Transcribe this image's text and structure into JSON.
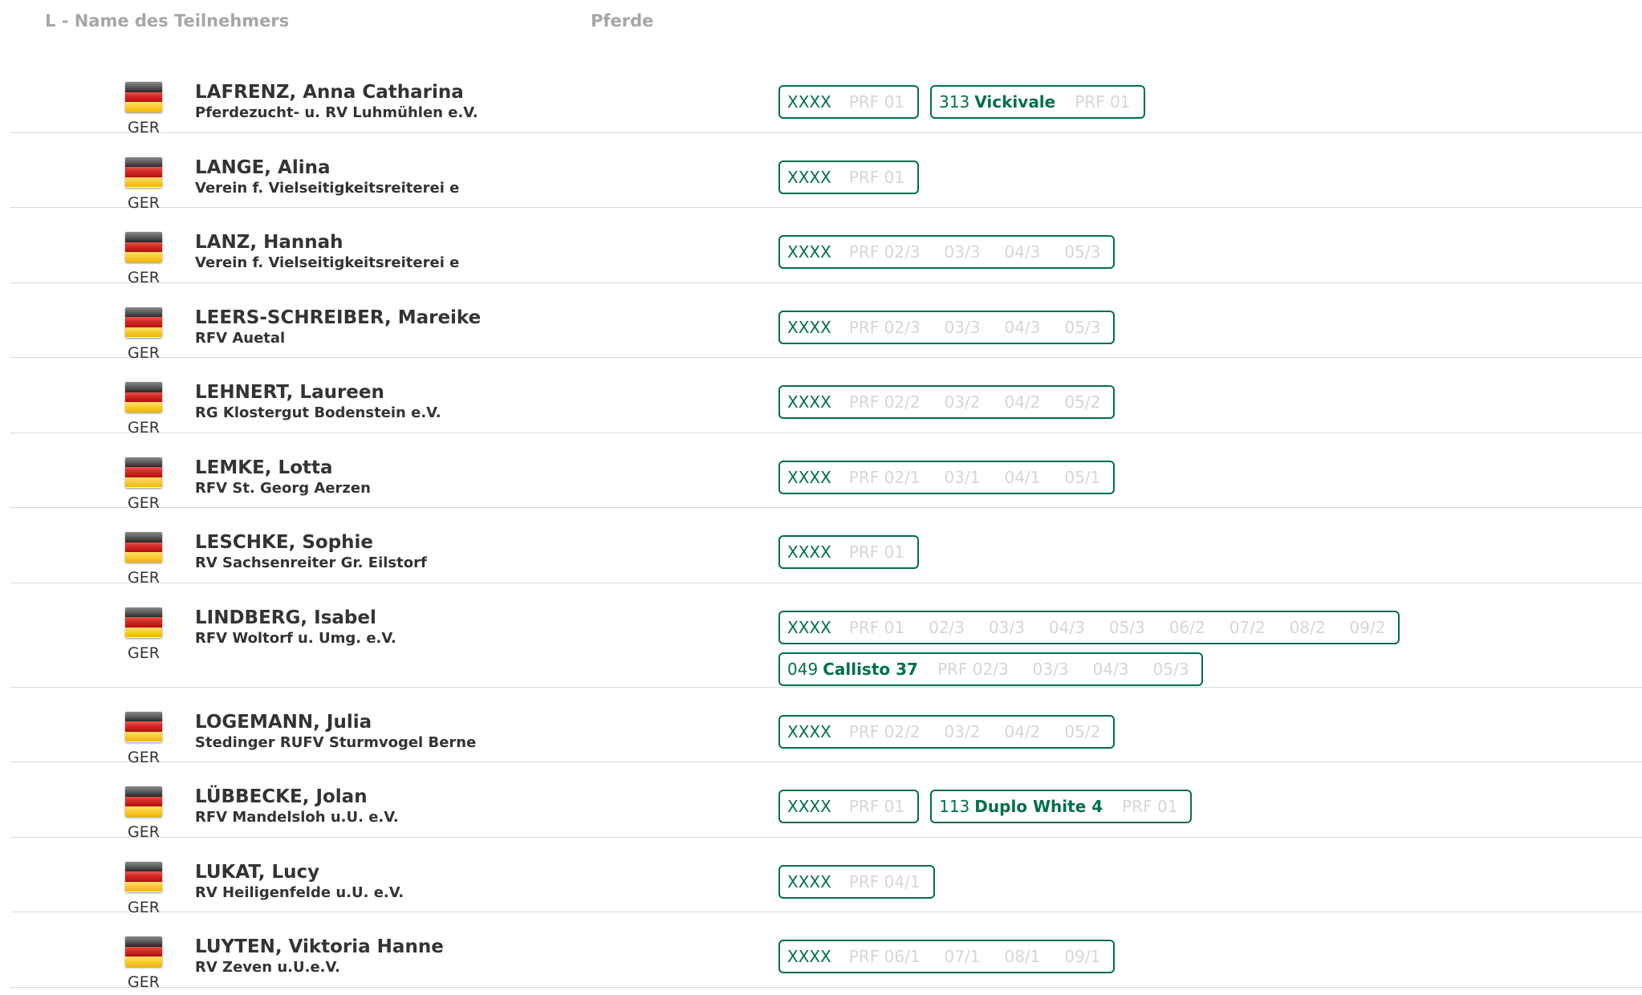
{
  "header": {
    "name_col": "L - Name des Teilnehmers",
    "horses_col": "Pferde"
  },
  "colors": {
    "accent": "#00704a",
    "muted": "#d6d6d6",
    "text": "#333333"
  },
  "riders": [
    {
      "name": "LAFRENZ, Anna Catharina",
      "club": "Pferdezucht- u. RV Luhmühlen e.V.",
      "country": "GER",
      "flag": "germany-flag-icon",
      "entry_lines": [
        [
          {
            "number": "XXXX",
            "horse": "",
            "results": [
              "PRF 01"
            ]
          },
          {
            "number": "313",
            "horse": "Vickivale",
            "results": [
              "PRF 01"
            ]
          }
        ]
      ]
    },
    {
      "name": "LANGE, Alina",
      "club": "Verein f. Vielseitigkeitsreiterei e",
      "country": "GER",
      "flag": "germany-flag-icon",
      "entry_lines": [
        [
          {
            "number": "XXXX",
            "horse": "",
            "results": [
              "PRF 01"
            ]
          }
        ]
      ]
    },
    {
      "name": "LANZ, Hannah",
      "club": "Verein f. Vielseitigkeitsreiterei e",
      "country": "GER",
      "flag": "germany-flag-icon",
      "entry_lines": [
        [
          {
            "number": "XXXX",
            "horse": "",
            "results": [
              "PRF 02/3",
              "03/3",
              "04/3",
              "05/3"
            ]
          }
        ]
      ]
    },
    {
      "name": "LEERS-SCHREIBER, Mareike",
      "club": "RFV Auetal",
      "country": "GER",
      "flag": "germany-flag-icon",
      "entry_lines": [
        [
          {
            "number": "XXXX",
            "horse": "",
            "results": [
              "PRF 02/3",
              "03/3",
              "04/3",
              "05/3"
            ]
          }
        ]
      ]
    },
    {
      "name": "LEHNERT, Laureen",
      "club": "RG Klostergut Bodenstein e.V.",
      "country": "GER",
      "flag": "germany-flag-icon",
      "entry_lines": [
        [
          {
            "number": "XXXX",
            "horse": "",
            "results": [
              "PRF 02/2",
              "03/2",
              "04/2",
              "05/2"
            ]
          }
        ]
      ]
    },
    {
      "name": "LEMKE, Lotta",
      "club": "RFV St. Georg Aerzen",
      "country": "GER",
      "flag": "germany-flag-icon",
      "entry_lines": [
        [
          {
            "number": "XXXX",
            "horse": "",
            "results": [
              "PRF 02/1",
              "03/1",
              "04/1",
              "05/1"
            ]
          }
        ]
      ]
    },
    {
      "name": "LESCHKE, Sophie",
      "club": "RV Sachsenreiter Gr. Eilstorf",
      "country": "GER",
      "flag": "germany-flag-icon",
      "entry_lines": [
        [
          {
            "number": "XXXX",
            "horse": "",
            "results": [
              "PRF 01"
            ]
          }
        ]
      ]
    },
    {
      "name": "LINDBERG, Isabel",
      "club": "RFV Woltorf u. Umg. e.V.",
      "country": "GER",
      "flag": "germany-flag-icon",
      "entry_lines": [
        [
          {
            "number": "XXXX",
            "horse": "",
            "results": [
              "PRF 01",
              "02/3",
              "03/3",
              "04/3",
              "05/3",
              "06/2",
              "07/2",
              "08/2",
              "09/2"
            ]
          }
        ],
        [
          {
            "number": "049",
            "horse": "Callisto 37",
            "results": [
              "PRF 02/3",
              "03/3",
              "04/3",
              "05/3"
            ]
          }
        ]
      ]
    },
    {
      "name": "LOGEMANN, Julia",
      "club": "Stedinger RUFV Sturmvogel Berne",
      "country": "GER",
      "flag": "germany-flag-icon",
      "entry_lines": [
        [
          {
            "number": "XXXX",
            "horse": "",
            "results": [
              "PRF 02/2",
              "03/2",
              "04/2",
              "05/2"
            ]
          }
        ]
      ]
    },
    {
      "name": "LÜBBECKE, Jolan",
      "club": "RFV Mandelsloh u.U. e.V.",
      "country": "GER",
      "flag": "germany-flag-icon",
      "entry_lines": [
        [
          {
            "number": "XXXX",
            "horse": "",
            "results": [
              "PRF 01"
            ]
          },
          {
            "number": "113",
            "horse": "Duplo White 4",
            "results": [
              "PRF 01"
            ]
          }
        ]
      ]
    },
    {
      "name": "LUKAT, Lucy",
      "club": "RV Heiligenfelde u.U. e.V.",
      "country": "GER",
      "flag": "germany-flag-icon",
      "entry_lines": [
        [
          {
            "number": "XXXX",
            "horse": "",
            "results": [
              "PRF 04/1"
            ]
          }
        ]
      ]
    },
    {
      "name": "LUYTEN, Viktoria Hanne",
      "club": "RV Zeven u.U.e.V.",
      "country": "GER",
      "flag": "germany-flag-icon",
      "entry_lines": [
        [
          {
            "number": "XXXX",
            "horse": "",
            "results": [
              "PRF 06/1",
              "07/1",
              "08/1",
              "09/1"
            ]
          }
        ]
      ]
    }
  ]
}
